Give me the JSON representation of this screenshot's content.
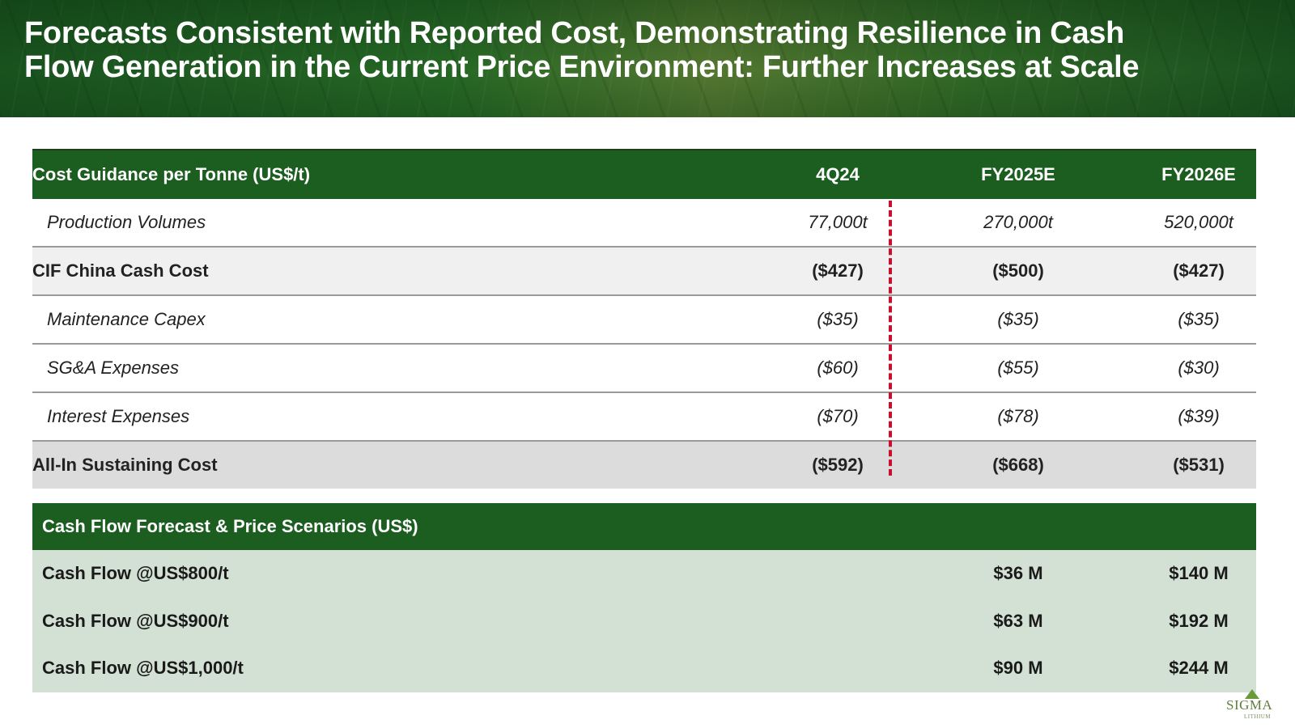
{
  "title": {
    "line1": "Forecasts Consistent with Reported Cost, Demonstrating Resilience in Cash",
    "line2": "Flow Generation in the Current Price Environment: Further Increases at Scale"
  },
  "cost_table": {
    "header": [
      "Cost Guidance per Tonne (US$/t)",
      "4Q24",
      "FY2025E",
      "FY2026E"
    ],
    "rows": [
      {
        "label": "Production Volumes",
        "values": [
          "77,000t",
          "270,000t",
          "520,000t"
        ]
      },
      {
        "label": "CIF China Cash Cost",
        "values": [
          "($427)",
          "($500)",
          "($427)"
        ]
      },
      {
        "label": "Maintenance Capex",
        "values": [
          "($35)",
          "($35)",
          "($35)"
        ]
      },
      {
        "label": "SG&A Expenses",
        "values": [
          "($60)",
          "($55)",
          "($30)"
        ]
      },
      {
        "label": "Interest Expenses",
        "values": [
          "($70)",
          "($78)",
          "($39)"
        ]
      },
      {
        "label": "All-In Sustaining Cost",
        "values": [
          "($592)",
          "($668)",
          "($531)"
        ]
      }
    ]
  },
  "cash_flow_table": {
    "header": "Cash Flow Forecast & Price Scenarios (US$)",
    "rows": [
      {
        "label": "Cash Flow @US$800/t",
        "values": [
          "$36 M",
          "$140 M"
        ]
      },
      {
        "label": "Cash Flow @US$900/t",
        "values": [
          "$63 M",
          "$192 M"
        ]
      },
      {
        "label": "Cash Flow @US$1,000/t",
        "values": [
          "$90 M",
          "$244 M"
        ]
      }
    ]
  },
  "logo": {
    "name": "SIGMA",
    "sub": "LITHIUM"
  },
  "colors": {
    "header_green": "#1b5e20",
    "divider_red": "#c8102e",
    "cash_flow_bg": "#d3e0d4"
  }
}
